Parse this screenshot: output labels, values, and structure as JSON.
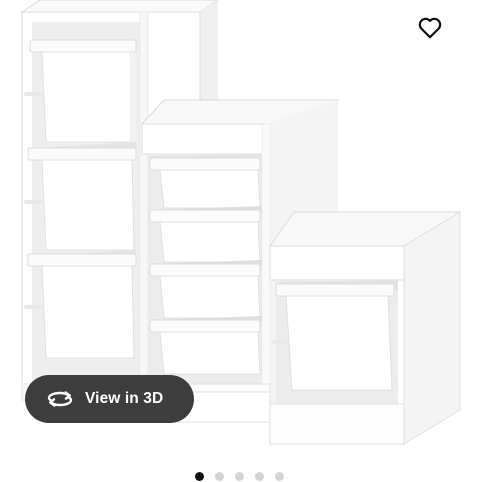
{
  "product": {
    "favorite_icon": "heart-outline-icon",
    "view3d_icon": "rotate-3d-icon",
    "view3d_label": "View in 3D"
  },
  "carousel": {
    "total_slides": 5,
    "active_index": 0
  },
  "colors": {
    "button_bg": "#3d3d3d",
    "dot_active": "#111111",
    "dot_inactive": "#d3d3d3"
  }
}
